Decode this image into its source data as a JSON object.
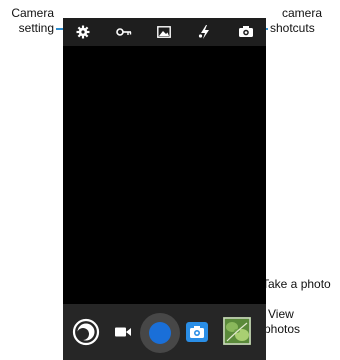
{
  "callouts": {
    "camera_setting": [
      "Camera",
      "setting"
    ],
    "camera_shortcuts": [
      "camera",
      "shotcuts"
    ],
    "take_photo": "Take a photo",
    "view_photos": [
      "View",
      "photos"
    ]
  },
  "topbar_icons": [
    "gear-icon",
    "key-icon",
    "image-icon",
    "flash-icon",
    "camera-switch-icon"
  ],
  "bottombar_icons": [
    "mode-dial-icon",
    "video-camera-icon",
    "shutter-button",
    "photo-camera-icon",
    "gallery-thumbnail"
  ],
  "colors": {
    "accent": "#2f8fd0",
    "shutter": "#1a6fd8",
    "photo_mode_badge": "#2a8ee6"
  }
}
